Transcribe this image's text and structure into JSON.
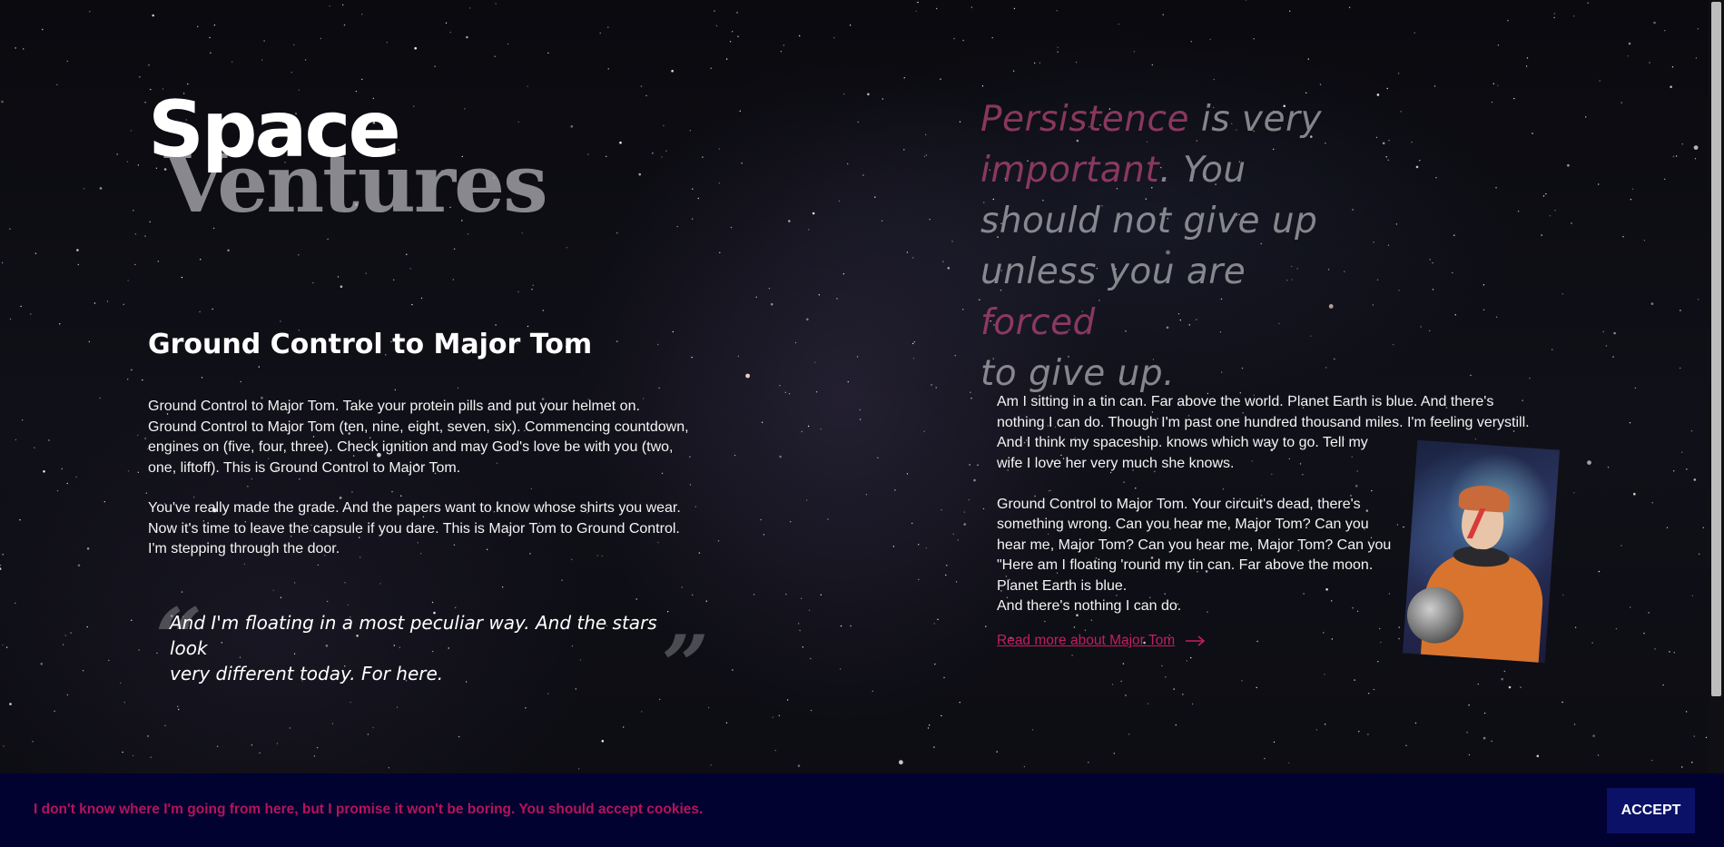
{
  "brand": {
    "line1": "Space",
    "line2": "Ventures"
  },
  "left": {
    "heading": "Ground Control to Major Tom",
    "paragraph1_lines": [
      "Ground Control to Major Tom. Take your protein pills and put your helmet on.",
      "Ground Control to Major Tom (ten, nine, eight, seven, six). Commencing countdown,",
      "engines on (five, four, three). Check ignition and may God's love be with you (two,",
      "one, liftoff). This is Ground Control to Major Tom."
    ],
    "paragraph2_lines": [
      "You've really made the grade. And the papers want to know whose shirts you wear.",
      "Now it's time to leave the capsule if you dare. This is Major Tom to Ground Control.",
      "I'm stepping through the door."
    ],
    "quote_lines": [
      "And I'm floating in a most peculiar way. And the stars look",
      "very different today. For here."
    ],
    "quote_open": "“",
    "quote_close": "”"
  },
  "right": {
    "persistence_quote": [
      [
        {
          "t": "Persistence",
          "hl": true
        },
        {
          "t": " is very",
          "hl": false
        }
      ],
      [
        {
          "t": "important",
          "hl": true
        },
        {
          "t": ". You",
          "hl": false
        }
      ],
      [
        {
          "t": "should not give up",
          "hl": false
        }
      ],
      [
        {
          "t": "unless you are ",
          "hl": false
        },
        {
          "t": "forced",
          "hl": true
        }
      ],
      [
        {
          "t": "to give up.",
          "hl": false
        }
      ]
    ],
    "body_lines_1": [
      "Am I sitting in a tin can. Far above the world. Planet Earth is blue. And there's",
      "nothing I can do. Though I'm past one hundred thousand miles. I'm feeling verystill.",
      "And I think my spaceship. knows which way to go. Tell my",
      "wife I love her very much she knows."
    ],
    "body_lines_2": [
      "Ground Control to Major Tom. Your circuit's dead, there's",
      "something wrong. Can you hear me, Major Tom? Can you",
      "hear me, Major Tom? Can you hear me, Major Tom? Can you",
      "\"Here am I floating 'round my tin can. Far above the moon.",
      "Planet Earth is blue.",
      "And there's nothing I can do."
    ],
    "read_more": "Read more about Major Tom",
    "portrait_icon": "astronaut-portrait"
  },
  "cookie": {
    "message": "I don't know where I'm going from here, but I promise it won't be boring. You should accept cookies.",
    "accept_label": "ACCEPT"
  },
  "colors": {
    "accent": "#c51d63",
    "cookie_bg": "#020231",
    "cookie_text": "#b2155a",
    "button_bg": "#0a1166"
  }
}
